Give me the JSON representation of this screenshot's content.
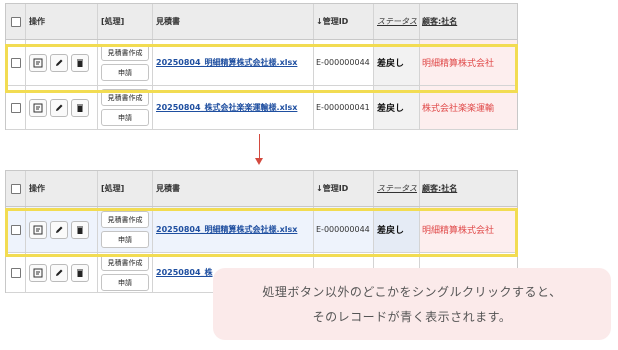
{
  "headers": {
    "ops": "操作",
    "proc": "[処理]",
    "file": "見積書",
    "id": "↓管理ID",
    "status": "ステータス",
    "customer": "顧客:社名"
  },
  "buttons": {
    "create_quote": "見積書作成",
    "apply": "申請"
  },
  "rows_before": [
    {
      "file": "20250804_明細精算株式会社様.xlsx",
      "id": "E-000000044",
      "status": "差戻し",
      "customer": "明細精算株式会社"
    },
    {
      "file": "20250804_株式会社楽楽運輸様.xlsx",
      "id": "E-000000041",
      "status": "差戻し",
      "customer": "株式会社楽楽運輸"
    }
  ],
  "rows_after": [
    {
      "file": "20250804_明細精算株式会社様.xlsx",
      "id": "E-000000044",
      "status": "差戻し",
      "customer": "明細精算株式会社"
    },
    {
      "file": "20250804_株"
    }
  ],
  "note": {
    "line1": "処理ボタン以外のどこかをシングルクリックすると、",
    "line2": "そのレコードが青く表示されます。"
  },
  "colors": {
    "highlight": "#f2dc52",
    "arrow": "#d34a3f",
    "selected_row": "#eef3fc",
    "link": "#1f4fa0",
    "customer_text": "#e04848",
    "note_bg": "#fbeaea"
  },
  "icons": [
    "checkbox",
    "view-icon",
    "pencil-icon",
    "trash-icon",
    "arrow-down-icon"
  ]
}
